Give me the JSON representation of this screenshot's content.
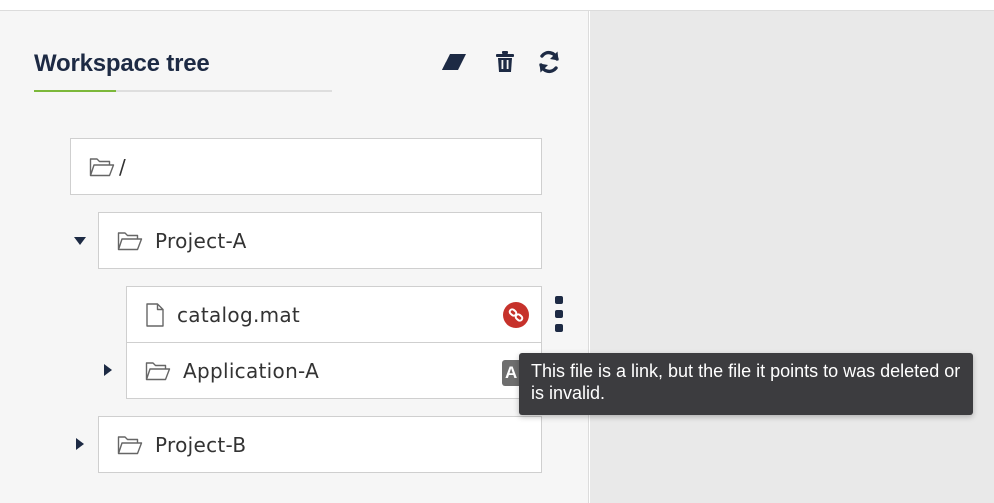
{
  "panel": {
    "title": "Workspace tree",
    "accent_color": "#7cb83a",
    "toolbar": {
      "clear_icon": "eraser-icon",
      "delete_icon": "trash-icon",
      "refresh_icon": "refresh-icon"
    }
  },
  "tree": {
    "root": {
      "label": "/",
      "icon": "folder-open-icon"
    },
    "items": [
      {
        "label": "Project-A",
        "icon": "folder-open-icon",
        "expanded": true
      },
      {
        "label": "catalog.mat",
        "icon": "file-icon",
        "status": "broken-link-icon"
      },
      {
        "label": "Application-A",
        "icon": "folder-open-icon",
        "expanded": false,
        "badge": "A"
      },
      {
        "label": "Project-B",
        "icon": "folder-open-icon",
        "expanded": false
      }
    ]
  },
  "tooltip": {
    "text": "This file is a link, but the file it points to was deleted or is invalid."
  },
  "colors": {
    "title": "#1d2a44",
    "broken_badge": "#c6322b",
    "tooltip_bg": "#3c3c3f"
  }
}
